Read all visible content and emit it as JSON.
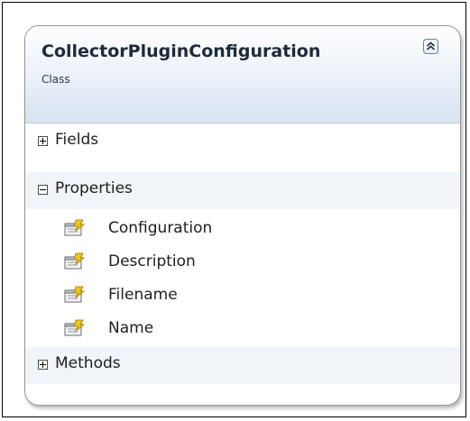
{
  "class_shape": {
    "name": "CollectorPluginConfiguration",
    "kind": "Class",
    "collapse_icon": "double-chevron-up-icon",
    "sections": {
      "fields": {
        "label": "Fields",
        "state": "collapsed"
      },
      "properties": {
        "label": "Properties",
        "state": "expanded",
        "items": [
          {
            "label": "Configuration",
            "icon": "property-icon"
          },
          {
            "label": "Description",
            "icon": "property-icon"
          },
          {
            "label": "Filename",
            "icon": "property-icon"
          },
          {
            "label": "Name",
            "icon": "property-icon"
          }
        ]
      },
      "methods": {
        "label": "Methods",
        "state": "collapsed"
      }
    }
  },
  "colors": {
    "header_gradient_end": "#d8e3f1",
    "section_alt_background": "#f1f4f8",
    "shape_border": "#959595"
  }
}
